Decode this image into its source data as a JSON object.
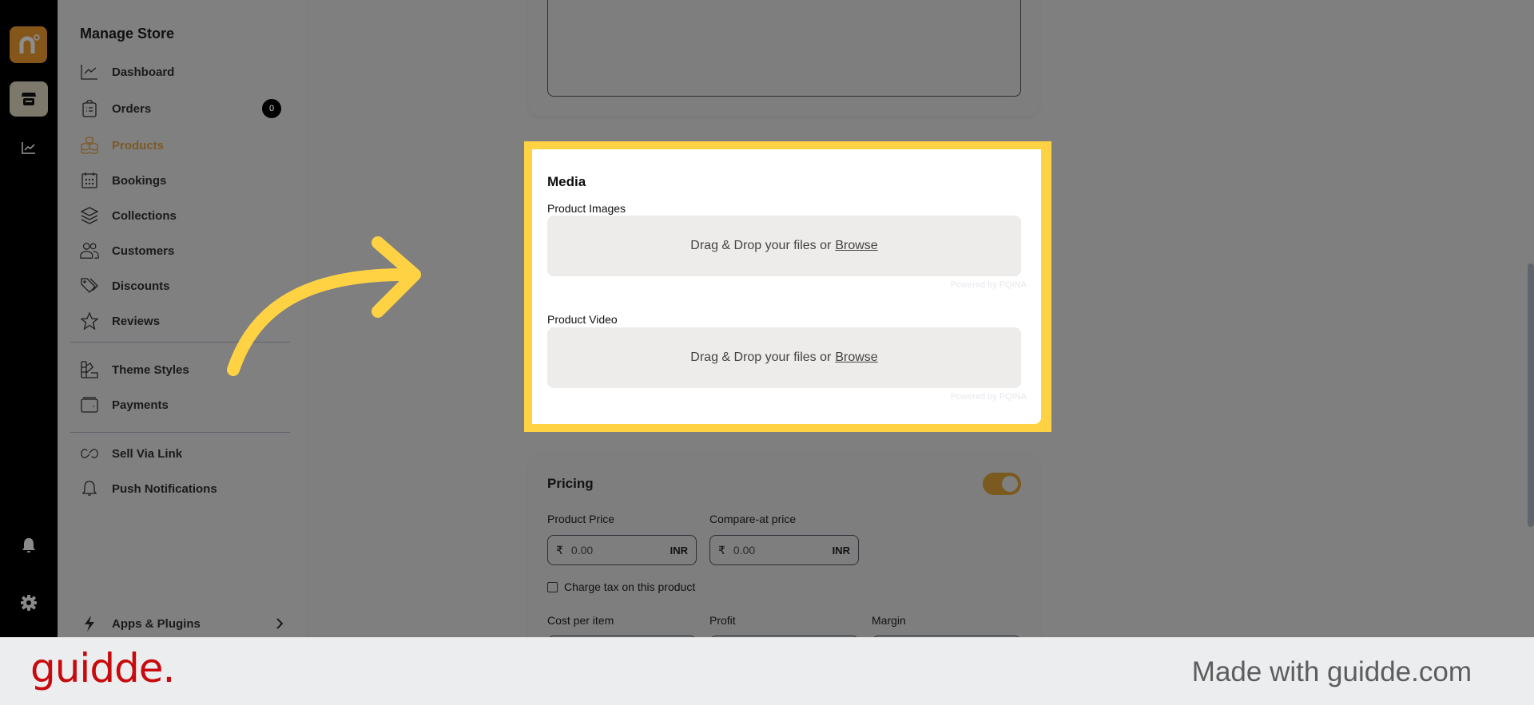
{
  "rail": {
    "logo_icon": "brand-logo-n",
    "items": [
      {
        "name": "store",
        "icon": "store-icon",
        "active": true
      },
      {
        "name": "analytics",
        "icon": "chart-icon",
        "active": false
      }
    ],
    "bottom_items": [
      {
        "name": "notifications",
        "icon": "bell-icon"
      },
      {
        "name": "settings",
        "icon": "gear-icon"
      }
    ]
  },
  "sidebar": {
    "title": "Manage Store",
    "items": [
      {
        "label": "Dashboard",
        "icon": "chart-line-icon"
      },
      {
        "label": "Orders",
        "icon": "clipboard-icon",
        "badge": "0"
      },
      {
        "label": "Products",
        "icon": "boxes-icon",
        "active": true
      },
      {
        "label": "Bookings",
        "icon": "calendar-icon"
      },
      {
        "label": "Collections",
        "icon": "layers-icon"
      },
      {
        "label": "Customers",
        "icon": "users-icon"
      },
      {
        "label": "Discounts",
        "icon": "tag-icon"
      },
      {
        "label": "Reviews",
        "icon": "star-icon"
      }
    ],
    "group2": [
      {
        "label": "Theme Styles",
        "icon": "palette-icon"
      },
      {
        "label": "Payments",
        "icon": "wallet-icon"
      }
    ],
    "group3": [
      {
        "label": "Sell Via Link",
        "icon": "link-icon"
      },
      {
        "label": "Push Notifications",
        "icon": "bell-icon"
      }
    ],
    "footer_item": {
      "label": "Apps & Plugins",
      "icon": "bolt-icon"
    }
  },
  "media": {
    "title": "Media",
    "images_label": "Product Images",
    "video_label": "Product Video",
    "dropzone_text": "Drag & Drop your files or",
    "browse_label": "Browse",
    "powered_by": "Powered by PQINA"
  },
  "pricing": {
    "title": "Pricing",
    "toggle_on": true,
    "product_price": {
      "label": "Product Price",
      "currency_symbol": "₹",
      "placeholder": "0.00",
      "code": "INR"
    },
    "compare_price": {
      "label": "Compare-at price",
      "currency_symbol": "₹",
      "placeholder": "0.00",
      "code": "INR"
    },
    "charge_tax_label": "Charge tax on this product",
    "charge_tax_checked": false,
    "cost_label": "Cost per item",
    "profit_label": "Profit",
    "margin_label": "Margin"
  },
  "footer": {
    "logo": "guidde.",
    "made_with": "Made with guidde.com"
  },
  "colors": {
    "highlight": "#ffd244",
    "brand_red": "#c8090d",
    "active_item": "#7c5a27"
  }
}
